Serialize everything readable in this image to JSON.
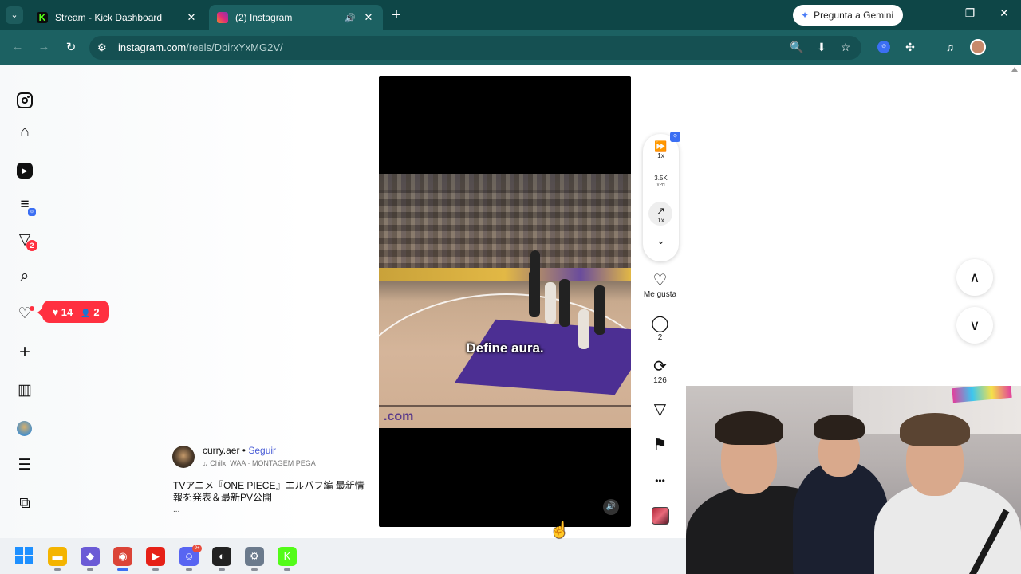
{
  "browser": {
    "tabs": [
      {
        "title": "Stream - Kick Dashboard",
        "favicon": "kick-icon",
        "favicon_glyph": "K",
        "close": "✕"
      },
      {
        "title": "(2) Instagram",
        "favicon": "instagram-icon",
        "audio": "🔊",
        "close": "✕"
      }
    ],
    "tab_menu_glyph": "⌄",
    "new_tab_glyph": "+",
    "gemini_label": "Pregunta a Gemini",
    "gemini_glyph": "✦",
    "window_controls": {
      "minimize": "—",
      "restore": "❐",
      "close": "✕"
    },
    "nav": {
      "back": "←",
      "forward": "→",
      "reload": "↻"
    },
    "url_icon": "⚙",
    "url_domain": "instagram.com",
    "url_path": "/reels/DbirxYxMG2V/",
    "addr_icons": {
      "zoom": "🔍",
      "install": "⬇",
      "bookmark": "☆",
      "extension_badge": "⊙",
      "extensions": "✣",
      "media": "♫"
    }
  },
  "sidebar": {
    "icons": {
      "home": "⌂",
      "reels": "▶",
      "filter": "≡",
      "messages": "▽",
      "search": "⌕",
      "notifications": "♡",
      "create": "+",
      "dashboard": "▥",
      "menu": "☰",
      "apps": "⧉"
    },
    "messages_badge": "2",
    "filter_badge": "⊙",
    "notifications_popup": {
      "likes": "14",
      "followers": "2",
      "heart": "♥",
      "person": "👤"
    }
  },
  "reel": {
    "caption": "Define aura.",
    "court_word": ".com",
    "mute_glyph": "🔊",
    "author": "curry.aer",
    "separator": "•",
    "follow": "Seguir",
    "audio_note": "♫",
    "audio_text": "Chilx, WAA · MONTAGEM PEGA",
    "description": "TVアニメ『ONE PIECE』エルバフ編 最新情報を発表＆最新PV公開",
    "more": "..."
  },
  "extension_panel": {
    "speed_icon": "⏩",
    "speed_label": "1x",
    "vph_value": "3.5K",
    "vph_label": "VPH",
    "trend_icon": "↗",
    "trend_label": "1x",
    "collapse_icon": "⌄",
    "badge": "⊙"
  },
  "actions": {
    "like_icon": "♡",
    "like_label": "Me gusta",
    "comment_icon": "◯",
    "comments": "2",
    "repost_icon": "⟳",
    "reposts": "126",
    "share_icon": "▽",
    "save_icon": "⚑",
    "more_icon": "•••"
  },
  "navigation": {
    "up": "∧",
    "down": "∨"
  },
  "taskbar": {
    "icons": [
      {
        "name": "file-explorer-icon",
        "glyph": "▬",
        "color": "#f4b400"
      },
      {
        "name": "stream-app-icon",
        "glyph": "◆",
        "color": "#6b5bd6"
      },
      {
        "name": "chrome-icon",
        "glyph": "◉",
        "color": "#db4437"
      },
      {
        "name": "youtube-music-icon",
        "glyph": "▶",
        "color": "#e62117"
      },
      {
        "name": "discord-icon",
        "glyph": "☺",
        "color": "#5865f2"
      },
      {
        "name": "obs-icon",
        "glyph": "◐",
        "color": "#222222"
      },
      {
        "name": "settings-icon",
        "glyph": "⚙",
        "color": "#6b7a8c"
      },
      {
        "name": "kick-icon",
        "glyph": "K",
        "color": "#53fc18"
      }
    ],
    "discord_badge": "9+"
  },
  "cursor_glyph": "☝"
}
